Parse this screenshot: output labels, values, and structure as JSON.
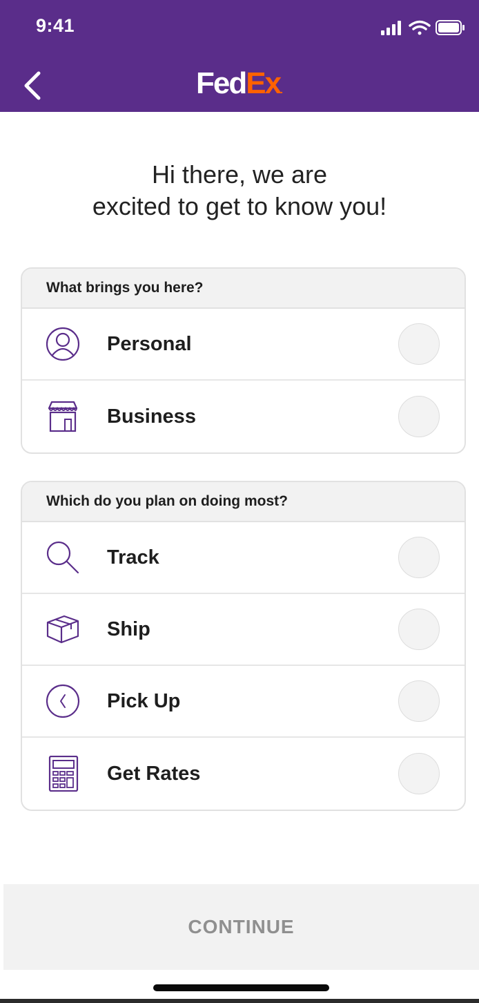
{
  "status_bar": {
    "time": "9:41",
    "icons": [
      "signal-icon",
      "wifi-icon",
      "battery-icon"
    ]
  },
  "header": {
    "back_icon": "chevron-left-icon",
    "logo_fed": "Fed",
    "logo_ex": "Ex",
    "logo_dot": ".",
    "brand_color": "#5a2d8a",
    "accent_color": "#ff6200"
  },
  "greeting": {
    "line1": "Hi there, we are",
    "line2": "excited to get to know you!"
  },
  "section1": {
    "title": "What brings you here?",
    "options": [
      {
        "label": "Personal",
        "icon": "person-icon",
        "selected": false
      },
      {
        "label": "Business",
        "icon": "storefront-icon",
        "selected": false
      }
    ]
  },
  "section2": {
    "title": "Which do you plan on doing most?",
    "options": [
      {
        "label": "Track",
        "icon": "search-icon",
        "selected": false
      },
      {
        "label": "Ship",
        "icon": "package-icon",
        "selected": false
      },
      {
        "label": "Pick Up",
        "icon": "clock-icon",
        "selected": false
      },
      {
        "label": "Get Rates",
        "icon": "calculator-icon",
        "selected": false
      }
    ]
  },
  "footer": {
    "continue_label": "CONTINUE"
  }
}
